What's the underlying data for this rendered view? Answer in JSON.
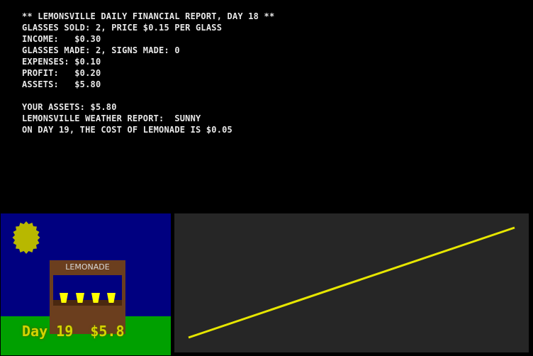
{
  "report": {
    "header": "** LEMONSVILLE DAILY FINANCIAL REPORT, DAY 18 **",
    "glasses_sold": "GLASSES SOLD: 2, PRICE $0.15 PER GLASS",
    "income": "INCOME:   $0.30",
    "glasses_made": "GLASSES MADE: 2, SIGNS MADE: 0",
    "expenses": "EXPENSES: $0.10",
    "profit": "PROFIT:   $0.20",
    "assets": "ASSETS:   $5.80",
    "your_assets": "YOUR ASSETS: $5.80",
    "weather": "LEMONSVILLE WEATHER REPORT:  SUNNY",
    "cost": "ON DAY 19, THE COST OF LEMONADE IS $0.05"
  },
  "scene": {
    "stand_sign": "LEMONADE",
    "day_label": "Day 19",
    "money_label": "$5.8",
    "cups_count": 4
  },
  "colors": {
    "sky": "#000080",
    "grass": "#00a000",
    "sun": "#b8b800",
    "stand": "#6b3e1e",
    "lemonade": "#ffff00",
    "graph_line": "#e6e600",
    "graph_bg": "#262626"
  },
  "chart_data": {
    "type": "line",
    "series": [
      {
        "values": [
          0,
          1
        ]
      }
    ],
    "grid": false
  }
}
